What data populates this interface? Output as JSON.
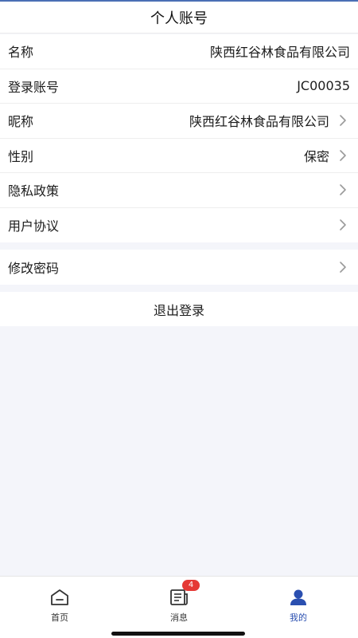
{
  "header": {
    "title": "个人账号"
  },
  "profile_rows": [
    {
      "label": "名称",
      "value": "陕西红谷林食品有限公司"
    },
    {
      "label": "登录账号",
      "value": "JC00035"
    },
    {
      "label": "昵称",
      "value": "陕西红谷林食品有限公司"
    },
    {
      "label": "性别",
      "value": "保密"
    },
    {
      "label": "隐私政策"
    },
    {
      "label": "用户协议"
    }
  ],
  "security_rows": [
    {
      "label": "修改密码"
    }
  ],
  "logout": {
    "label": "退出登录"
  },
  "tabbar": {
    "tabs": [
      {
        "label": "首页",
        "icon": "home-icon"
      },
      {
        "label": "消息",
        "icon": "message-icon",
        "badge": "4"
      },
      {
        "label": "我的",
        "icon": "user-icon",
        "active": true
      }
    ]
  },
  "colors": {
    "accent": "#2a4fb0",
    "badge": "#e53935",
    "background": "#f4f5fa"
  }
}
